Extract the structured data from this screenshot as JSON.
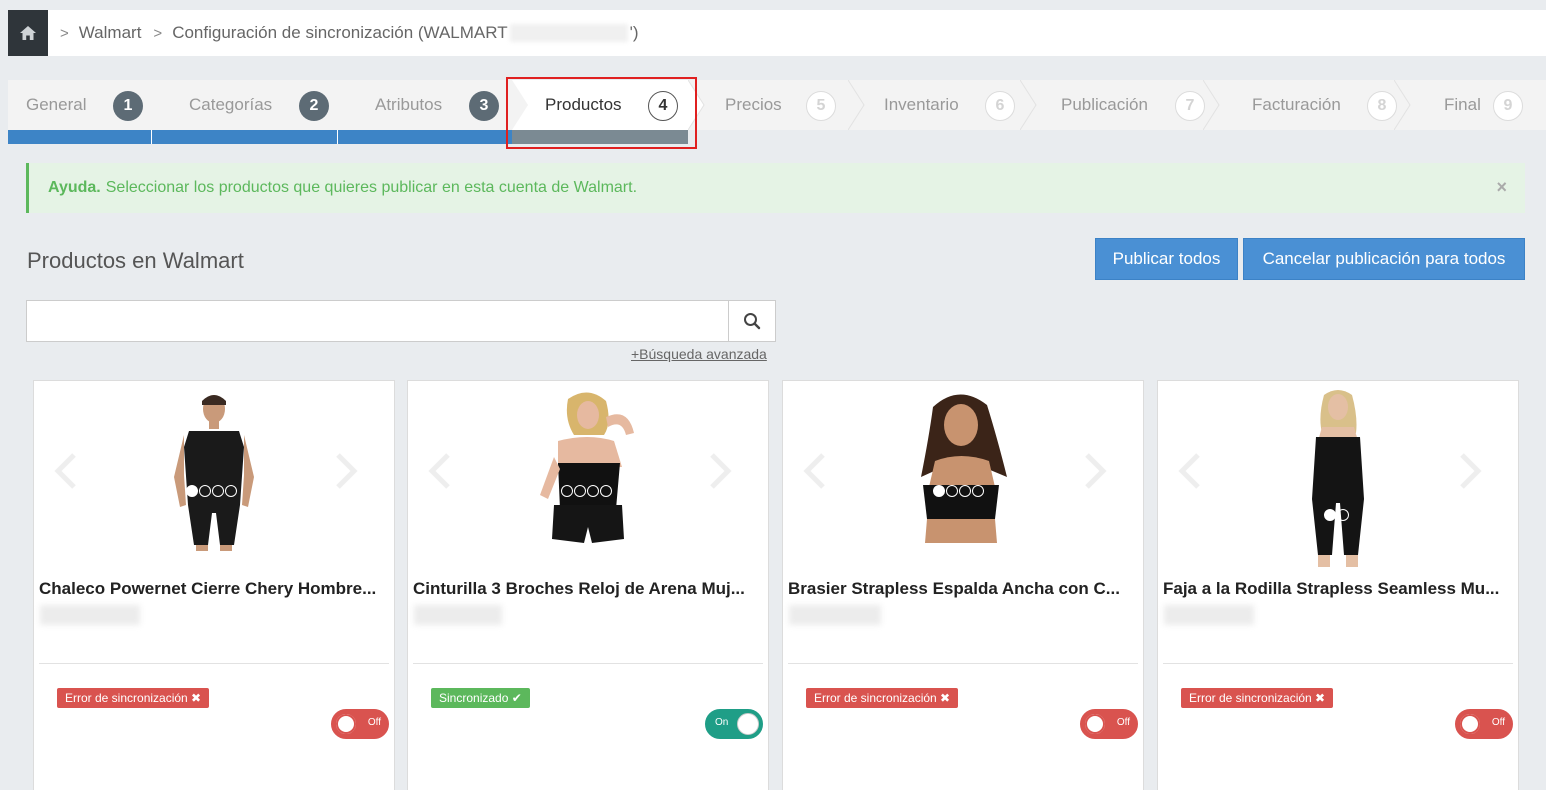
{
  "breadcrumb": {
    "home_icon": "home-icon",
    "items": [
      "Walmart",
      "Configuración de sincronización (WALMART",
      "')"
    ]
  },
  "wizard": {
    "steps": [
      {
        "label": "General",
        "number": "1",
        "state": "done"
      },
      {
        "label": "Categorías",
        "number": "2",
        "state": "done"
      },
      {
        "label": "Atributos",
        "number": "3",
        "state": "done"
      },
      {
        "label": "Productos",
        "number": "4",
        "state": "active"
      },
      {
        "label": "Precios",
        "number": "5",
        "state": "todo"
      },
      {
        "label": "Inventario",
        "number": "6",
        "state": "todo"
      },
      {
        "label": "Publicación",
        "number": "7",
        "state": "todo"
      },
      {
        "label": "Facturación",
        "number": "8",
        "state": "todo"
      },
      {
        "label": "Final",
        "number": "9",
        "state": "todo"
      }
    ]
  },
  "alert": {
    "strong": "Ayuda.",
    "text": "Seleccionar los productos que quieres publicar en esta cuenta de Walmart.",
    "close": "×"
  },
  "section": {
    "title": "Productos en Walmart",
    "publish_all": "Publicar todos",
    "cancel_all": "Cancelar publicación para todos"
  },
  "search": {
    "placeholder": "",
    "value": "",
    "advanced": "+Búsqueda avanzada"
  },
  "products": [
    {
      "title": "Chaleco Powernet Cierre Chery Hombre...",
      "status": "Error de sincronización ✖",
      "status_type": "error",
      "toggle": "Off",
      "image_dots": 4
    },
    {
      "title": "Cinturilla 3 Broches Reloj de Arena Muj...",
      "status": "Sincronizado ✔",
      "status_type": "ok",
      "toggle": "On",
      "image_dots": 4
    },
    {
      "title": "Brasier Strapless Espalda Ancha con C...",
      "status": "Error de sincronización ✖",
      "status_type": "error",
      "toggle": "Off",
      "image_dots": 4
    },
    {
      "title": "Faja a la Rodilla Strapless Seamless Mu...",
      "status": "Error de sincronización ✖",
      "status_type": "error",
      "toggle": "Off",
      "image_dots": 2
    }
  ],
  "colors": {
    "primary_button": "#4a90d4",
    "progress_done": "#3d84c6",
    "progress_active": "#7b8a93",
    "alert_green": "#5cb85c",
    "error_red": "#d9534f",
    "toggle_on": "#1f9e87",
    "highlight_box": "#e02020"
  }
}
